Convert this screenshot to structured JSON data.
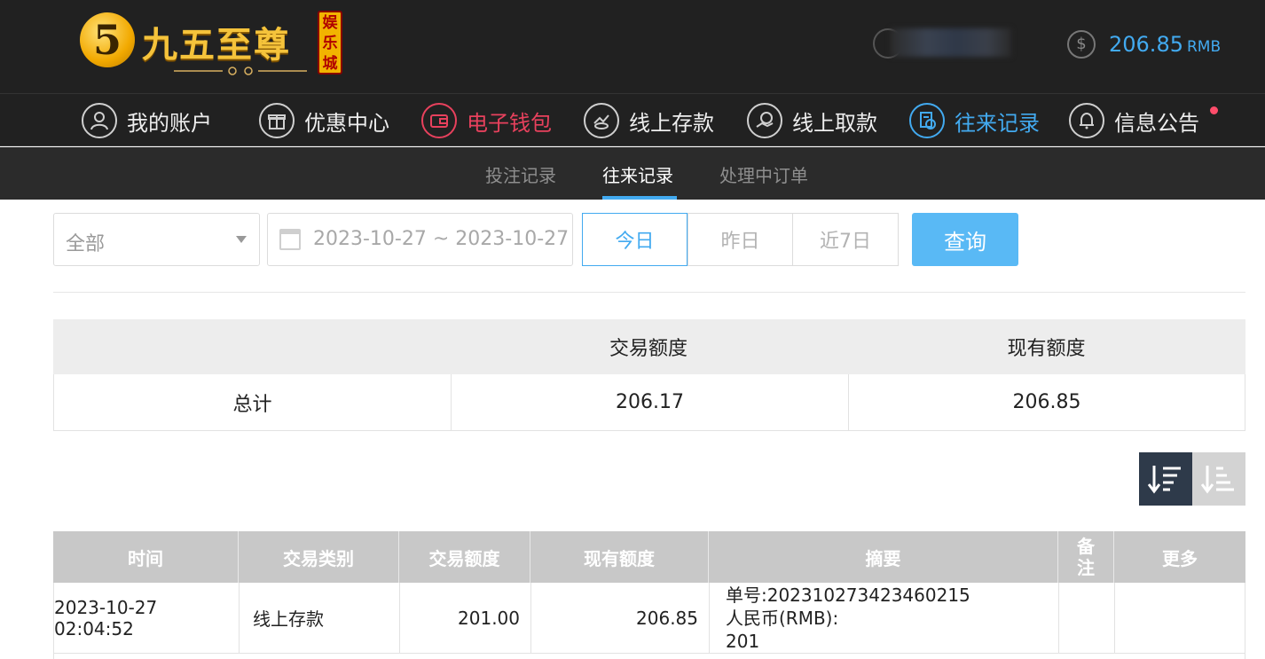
{
  "brand": {
    "logo_mark": "5",
    "name": "九五至尊",
    "seal_chars": [
      "娱",
      "乐",
      "城"
    ]
  },
  "header": {
    "balance_value": "206.85",
    "balance_currency": "RMB",
    "icons": [
      "user-icon",
      "dollar-coin-icon"
    ]
  },
  "main_nav": [
    {
      "label": "我的账户",
      "icon": "user-circle-icon"
    },
    {
      "label": "优惠中心",
      "icon": "gift-icon"
    },
    {
      "label": "电子钱包",
      "icon": "wallet-icon"
    },
    {
      "label": "线上存款",
      "icon": "deposit-icon"
    },
    {
      "label": "线上取款",
      "icon": "withdraw-icon"
    },
    {
      "label": "往来记录",
      "icon": "records-icon"
    },
    {
      "label": "信息公告",
      "icon": "bell-icon"
    }
  ],
  "colors": {
    "accent_blue": "#42aaf0",
    "accent_red": "#e8415d",
    "header_bg": "#212121"
  },
  "sub_nav": [
    {
      "label": "投注记录"
    },
    {
      "label": "往来记录"
    },
    {
      "label": "处理中订单"
    }
  ],
  "filters": {
    "type_select_value": "全部",
    "date_range": "2023-10-27 ~ 2023-10-27",
    "quick_ranges": [
      "今日",
      "昨日",
      "近7日"
    ],
    "query_label": "查询"
  },
  "summary": {
    "headers": [
      "",
      "交易额度",
      "现有额度"
    ],
    "row_label": "总计",
    "transaction_amount": "206.17",
    "current_amount": "206.85"
  },
  "detail": {
    "headers": [
      "时间",
      "交易类别",
      "交易额度",
      "现有额度",
      "摘要",
      "备注",
      "更多"
    ],
    "rows": [
      {
        "time": "2023-10-27 02:04:52",
        "type": "线上存款",
        "amount": "201.00",
        "balance": "206.85",
        "summary_line1": "单号:202310273423460215",
        "summary_line2": "人民币(RMB):",
        "summary_line3": "201",
        "remark": "",
        "more": ""
      }
    ]
  }
}
